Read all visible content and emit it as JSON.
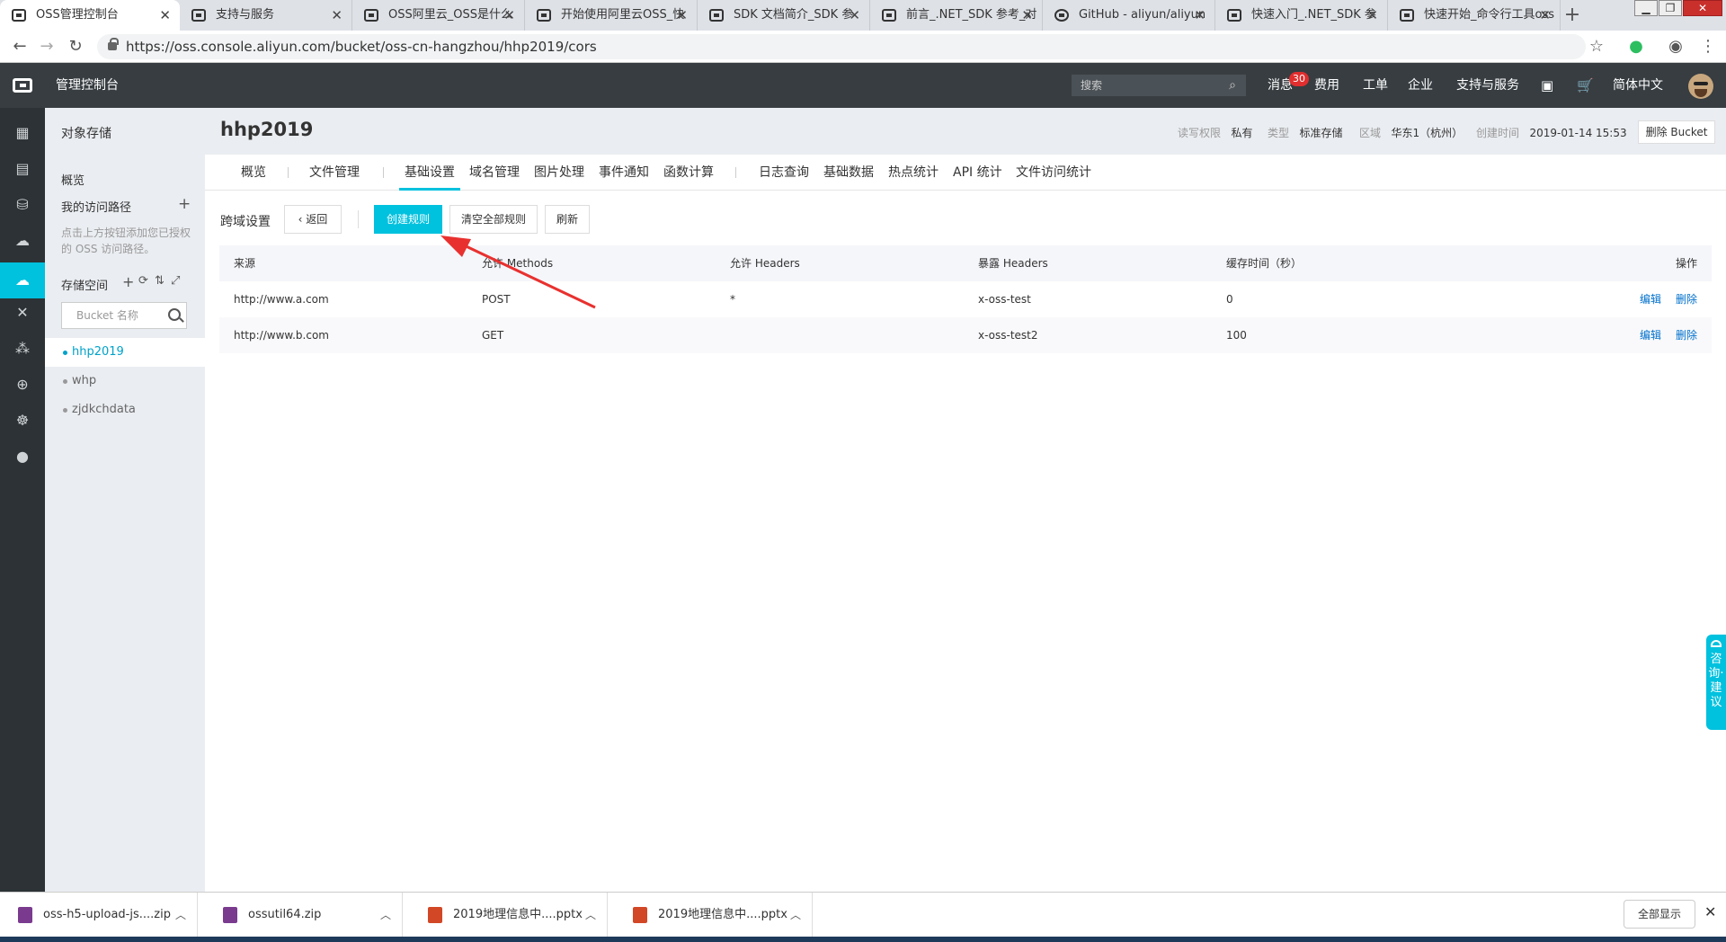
{
  "browser": {
    "tabs": [
      {
        "title": "OSS管理控制台",
        "active": true
      },
      {
        "title": "支持与服务"
      },
      {
        "title": "OSS阿里云_OSS是什么"
      },
      {
        "title": "开始使用阿里云OSS_快"
      },
      {
        "title": "SDK 文档简介_SDK 参"
      },
      {
        "title": "前言_.NET_SDK 参考_对"
      },
      {
        "title": "GitHub - aliyun/aliyun"
      },
      {
        "title": "快速入门_.NET_SDK 参"
      },
      {
        "title": "快速开始_命令行工具oss"
      }
    ],
    "url": "https://oss.console.aliyun.com/bucket/oss-cn-hangzhou/hhp2019/cors"
  },
  "topnav": {
    "brand": "管理控制台",
    "search_placeholder": "搜索",
    "messages": "消息",
    "badge": "30",
    "items": [
      "费用",
      "工单",
      "企业",
      "支持与服务"
    ],
    "lang": "简体中文"
  },
  "sidebar": {
    "title": "对象存储",
    "overview": "概览",
    "paths_label": "我的访问路径",
    "paths_hint": "点击上方按钮添加您已授权的 OSS 访问路径。",
    "storage_label": "存储空间",
    "bucket_search_placeholder": "Bucket 名称",
    "buckets": [
      "hhp2019",
      "whp",
      "zjdkchdata"
    ]
  },
  "bucket": {
    "name": "hhp2019",
    "acl_label": "读写权限",
    "acl_value": "私有",
    "type_label": "类型",
    "type_value": "标准存储",
    "region_label": "区域",
    "region_value": "华东1（杭州）",
    "created_label": "创建时间",
    "created_value": "2019-01-14 15:53",
    "delete_label": "删除 Bucket"
  },
  "tabs": [
    "概览",
    "文件管理",
    "基础设置",
    "域名管理",
    "图片处理",
    "事件通知",
    "函数计算",
    "日志查询",
    "基础数据",
    "热点统计",
    "API 统计",
    "文件访问统计"
  ],
  "toolbar": {
    "section": "跨域设置",
    "back": "返回",
    "create": "创建规则",
    "clear": "清空全部规则",
    "refresh": "刷新"
  },
  "table": {
    "headers": [
      "来源",
      "允许 Methods",
      "允许 Headers",
      "暴露 Headers",
      "缓存时间（秒）",
      "操作"
    ],
    "rows": [
      {
        "origin": "http://www.a.com",
        "methods": "POST",
        "allow_headers": "*",
        "expose_headers": "x-oss-test",
        "cache": "0",
        "edit": "编辑",
        "delete": "删除"
      },
      {
        "origin": "http://www.b.com",
        "methods": "GET",
        "allow_headers": "",
        "expose_headers": "x-oss-test2",
        "cache": "100",
        "edit": "编辑",
        "delete": "删除"
      }
    ]
  },
  "feedback": "咨询·建议",
  "downloads": {
    "items": [
      "oss-h5-upload-js....zip",
      "ossutil64.zip",
      "2019地理信息中....pptx",
      "2019地理信息中....pptx"
    ],
    "show_all": "全部显示"
  },
  "colors": {
    "accent": "#00c1de",
    "header": "#373d41",
    "link": "#0070cc",
    "arrow": "#e8312f"
  }
}
